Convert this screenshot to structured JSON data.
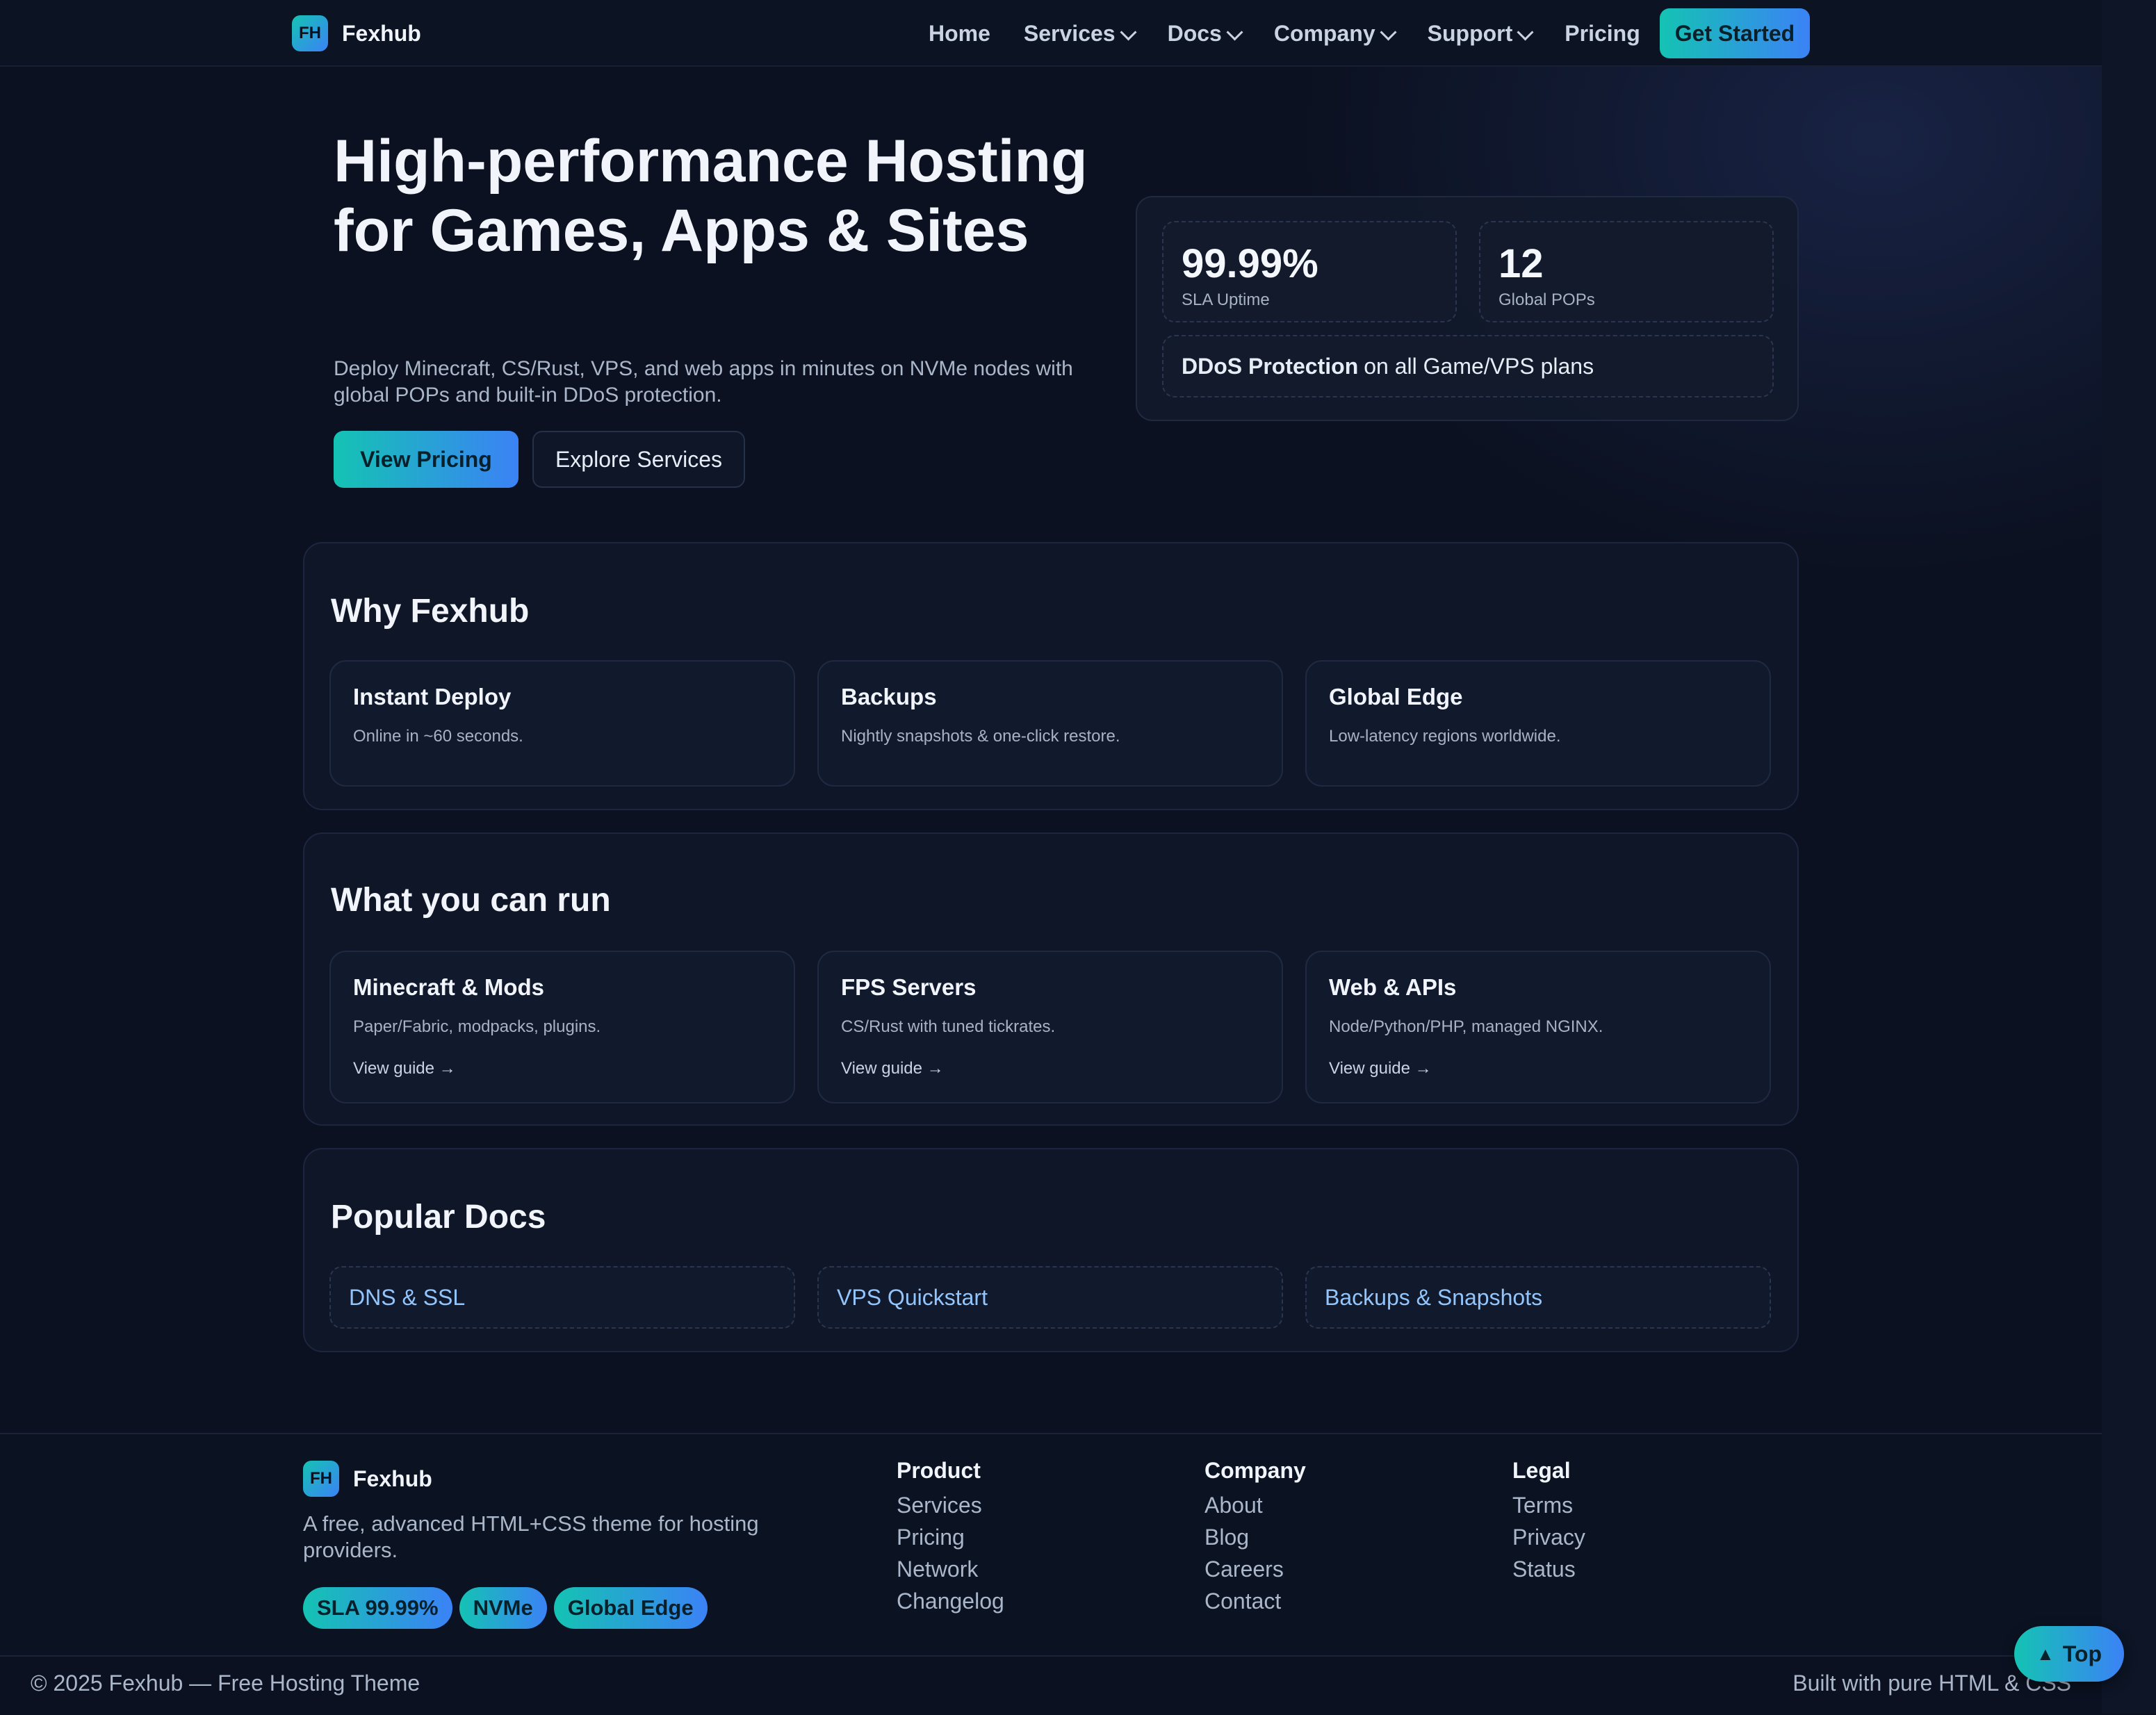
{
  "nav": {
    "logo_text": "FH",
    "brand": "Fexhub",
    "items": [
      {
        "label": "Home",
        "dropdown": false
      },
      {
        "label": "Services",
        "dropdown": true
      },
      {
        "label": "Docs",
        "dropdown": true
      },
      {
        "label": "Company",
        "dropdown": true
      },
      {
        "label": "Support",
        "dropdown": true
      },
      {
        "label": "Pricing",
        "dropdown": false
      }
    ],
    "cta": "Get Started"
  },
  "hero": {
    "title": "High-performance Hosting for Games, Apps & Sites",
    "subtitle": "Deploy Minecraft, CS/Rust, VPS, and web apps in minutes on NVMe nodes with global POPs and built-in DDoS protection.",
    "primary_button": "View Pricing",
    "secondary_button": "Explore Services",
    "stats": [
      {
        "value": "99.99%",
        "label": "SLA Uptime"
      },
      {
        "value": "12",
        "label": "Global POPs"
      }
    ],
    "ddos": {
      "strong": "DDoS Protection",
      "rest": "on all Game/VPS plans"
    }
  },
  "why": {
    "title": "Why Fexhub",
    "cards": [
      {
        "title": "Instant Deploy",
        "text": "Online in ~60 seconds."
      },
      {
        "title": "Backups",
        "text": "Nightly snapshots & one-click restore."
      },
      {
        "title": "Global Edge",
        "text": "Low-latency regions worldwide."
      }
    ]
  },
  "run": {
    "title": "What you can run",
    "cards": [
      {
        "title": "Minecraft & Mods",
        "text": "Paper/Fabric, modpacks, plugins.",
        "link": "View guide →"
      },
      {
        "title": "FPS Servers",
        "text": "CS/Rust with tuned tickrates.",
        "link": "View guide →"
      },
      {
        "title": "Web & APIs",
        "text": "Node/Python/PHP, managed NGINX.",
        "link": "View guide →"
      }
    ]
  },
  "docs": {
    "title": "Popular Docs",
    "links": [
      "DNS & SSL",
      "VPS Quickstart",
      "Backups & Snapshots"
    ]
  },
  "footer": {
    "logo_text": "FH",
    "brand": "Fexhub",
    "tagline": "A free, advanced HTML+CSS theme for hosting providers.",
    "badges": [
      "SLA 99.99%",
      "NVMe",
      "Global Edge"
    ],
    "columns": [
      {
        "title": "Product",
        "links": [
          "Services",
          "Pricing",
          "Network",
          "Changelog"
        ]
      },
      {
        "title": "Company",
        "links": [
          "About",
          "Blog",
          "Careers",
          "Contact"
        ]
      },
      {
        "title": "Legal",
        "links": [
          "Terms",
          "Privacy",
          "Status"
        ]
      }
    ],
    "copyright": "© 2025 Fexhub — Free Hosting Theme",
    "built_with": "Built with pure HTML & CSS"
  },
  "top_button": {
    "icon": "triangle-up-icon",
    "label": "Top"
  },
  "colors": {
    "background": "#0b1120",
    "accent_start": "#14c3b3",
    "accent_end": "#3b82f6",
    "link": "#93c5fd"
  }
}
